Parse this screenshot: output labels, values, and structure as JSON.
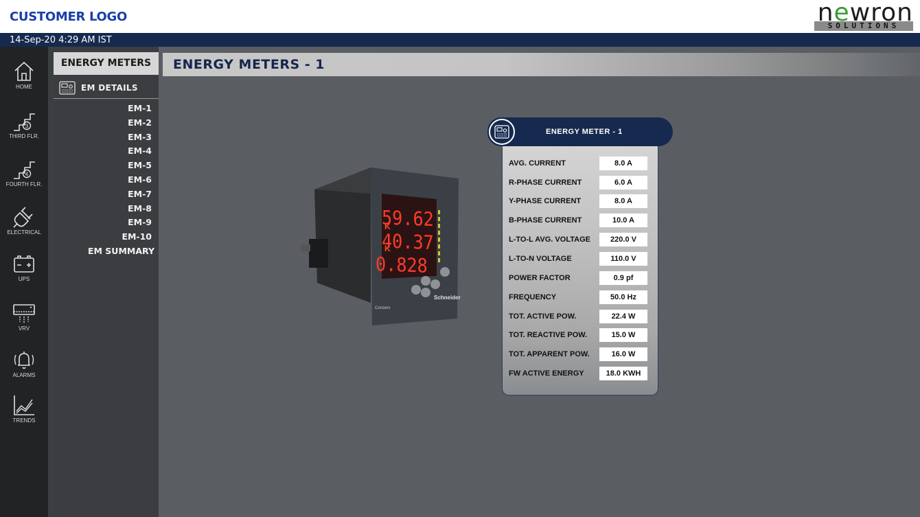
{
  "header": {
    "customer_logo": "CUSTOMER LOGO",
    "brand": {
      "word_prefix": "n",
      "word_accent": "e",
      "word_suffix": "wron",
      "sub": "SOLUTIONS"
    }
  },
  "datetime": "14-Sep-20 4:29 AM IST",
  "rail": [
    {
      "label": "HOME",
      "icon": "home-icon"
    },
    {
      "label": "THIRD FLR.",
      "icon": "stairs-3-icon"
    },
    {
      "label": "FOURTH FLR.",
      "icon": "stairs-4-icon"
    },
    {
      "label": "ELECTRICAL",
      "icon": "plug-icon"
    },
    {
      "label": "UPS",
      "icon": "battery-icon"
    },
    {
      "label": "VRV",
      "icon": "ac-unit-icon"
    },
    {
      "label": "ALARMS",
      "icon": "bell-icon"
    },
    {
      "label": "TRENDS",
      "icon": "trend-chart-icon"
    }
  ],
  "submenu": {
    "heading": "ENERGY METERS",
    "section": "EM DETAILS",
    "items": [
      "EM-1",
      "EM-2",
      "EM-3",
      "EM-4",
      "EM-5",
      "EM-6",
      "EM-7",
      "EM-8",
      "EM-9",
      "EM-10",
      "EM SUMMARY"
    ]
  },
  "page_title": "ENERGY METERS - 1",
  "device": {
    "readouts": [
      "59.62",
      "40.37",
      "0.828"
    ],
    "brand": "Schneider",
    "model": "Conzerv"
  },
  "panel": {
    "title": "ENERGY METER - 1",
    "rows": [
      {
        "label": "AVG. CURRENT",
        "value": "8.0 A"
      },
      {
        "label": "R-PHASE CURRENT",
        "value": "6.0 A"
      },
      {
        "label": "Y-PHASE CURRENT",
        "value": "8.0 A"
      },
      {
        "label": "B-PHASE CURRENT",
        "value": "10.0 A"
      },
      {
        "label": "L-TO-L AVG. VOLTAGE",
        "value": "220.0 V"
      },
      {
        "label": "L-TO-N VOLTAGE",
        "value": "110.0 V"
      },
      {
        "label": "POWER FACTOR",
        "value": "0.9 pf"
      },
      {
        "label": "FREQUENCY",
        "value": "50.0 Hz"
      },
      {
        "label": "TOT. ACTIVE POW.",
        "value": "22.4 W"
      },
      {
        "label": "TOT. REACTIVE POW.",
        "value": "15.0 W"
      },
      {
        "label": "TOT. APPARENT POW.",
        "value": "16.0 W"
      },
      {
        "label": "FW ACTIVE ENERGY",
        "value": "18.0 KWH"
      }
    ]
  },
  "colors": {
    "navy": "#16294e",
    "accent_green": "#3a9b36",
    "logo_blue": "#1a3ea8",
    "led_red": "#ff3b2a"
  }
}
